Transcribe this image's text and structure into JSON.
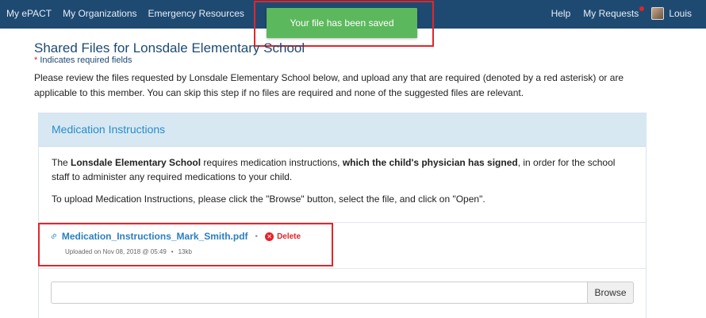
{
  "nav": {
    "left": [
      "My ePACT",
      "My Organizations",
      "Emergency Resources"
    ],
    "help": "Help",
    "requests": "My Requests",
    "user": "Louis"
  },
  "toast": {
    "message": "Your file has been saved",
    "color": "#5cb85c"
  },
  "page": {
    "title": "Shared Files for Lonsdale Elementary School",
    "required_star": "*",
    "required_note": "Indicates required fields",
    "intro": "Please review the files requested by Lonsdale Elementary School below, and upload any that are required (denoted by a red asterisk) or are applicable to this member. You can skip this step if no files are required and none of the suggested files are relevant."
  },
  "panel": {
    "title": "Medication Instructions",
    "desc_prefix": "The ",
    "desc_org": "Lonsdale Elementary School",
    "desc_mid": " requires medication instructions, ",
    "desc_bold": "which the child's physician has signed",
    "desc_suffix": ", in order for the school staff to administer any required medications to your child.",
    "upload_instructions": "To upload Medication Instructions, please click the \"Browse\" button, select the file, and click on \"Open\".",
    "file": {
      "name": "Medication_Instructions_Mark_Smith.pdf",
      "delete_label": "Delete",
      "uploaded": "Uploaded on Nov 08, 2018 @ 05:49",
      "size": "13kb"
    },
    "upload": {
      "value": "",
      "browse_label": "Browse"
    }
  },
  "colors": {
    "nav": "#1e4a72",
    "accent": "#2a8bc9",
    "danger": "#e0242a",
    "highlight": "#e2262b"
  }
}
